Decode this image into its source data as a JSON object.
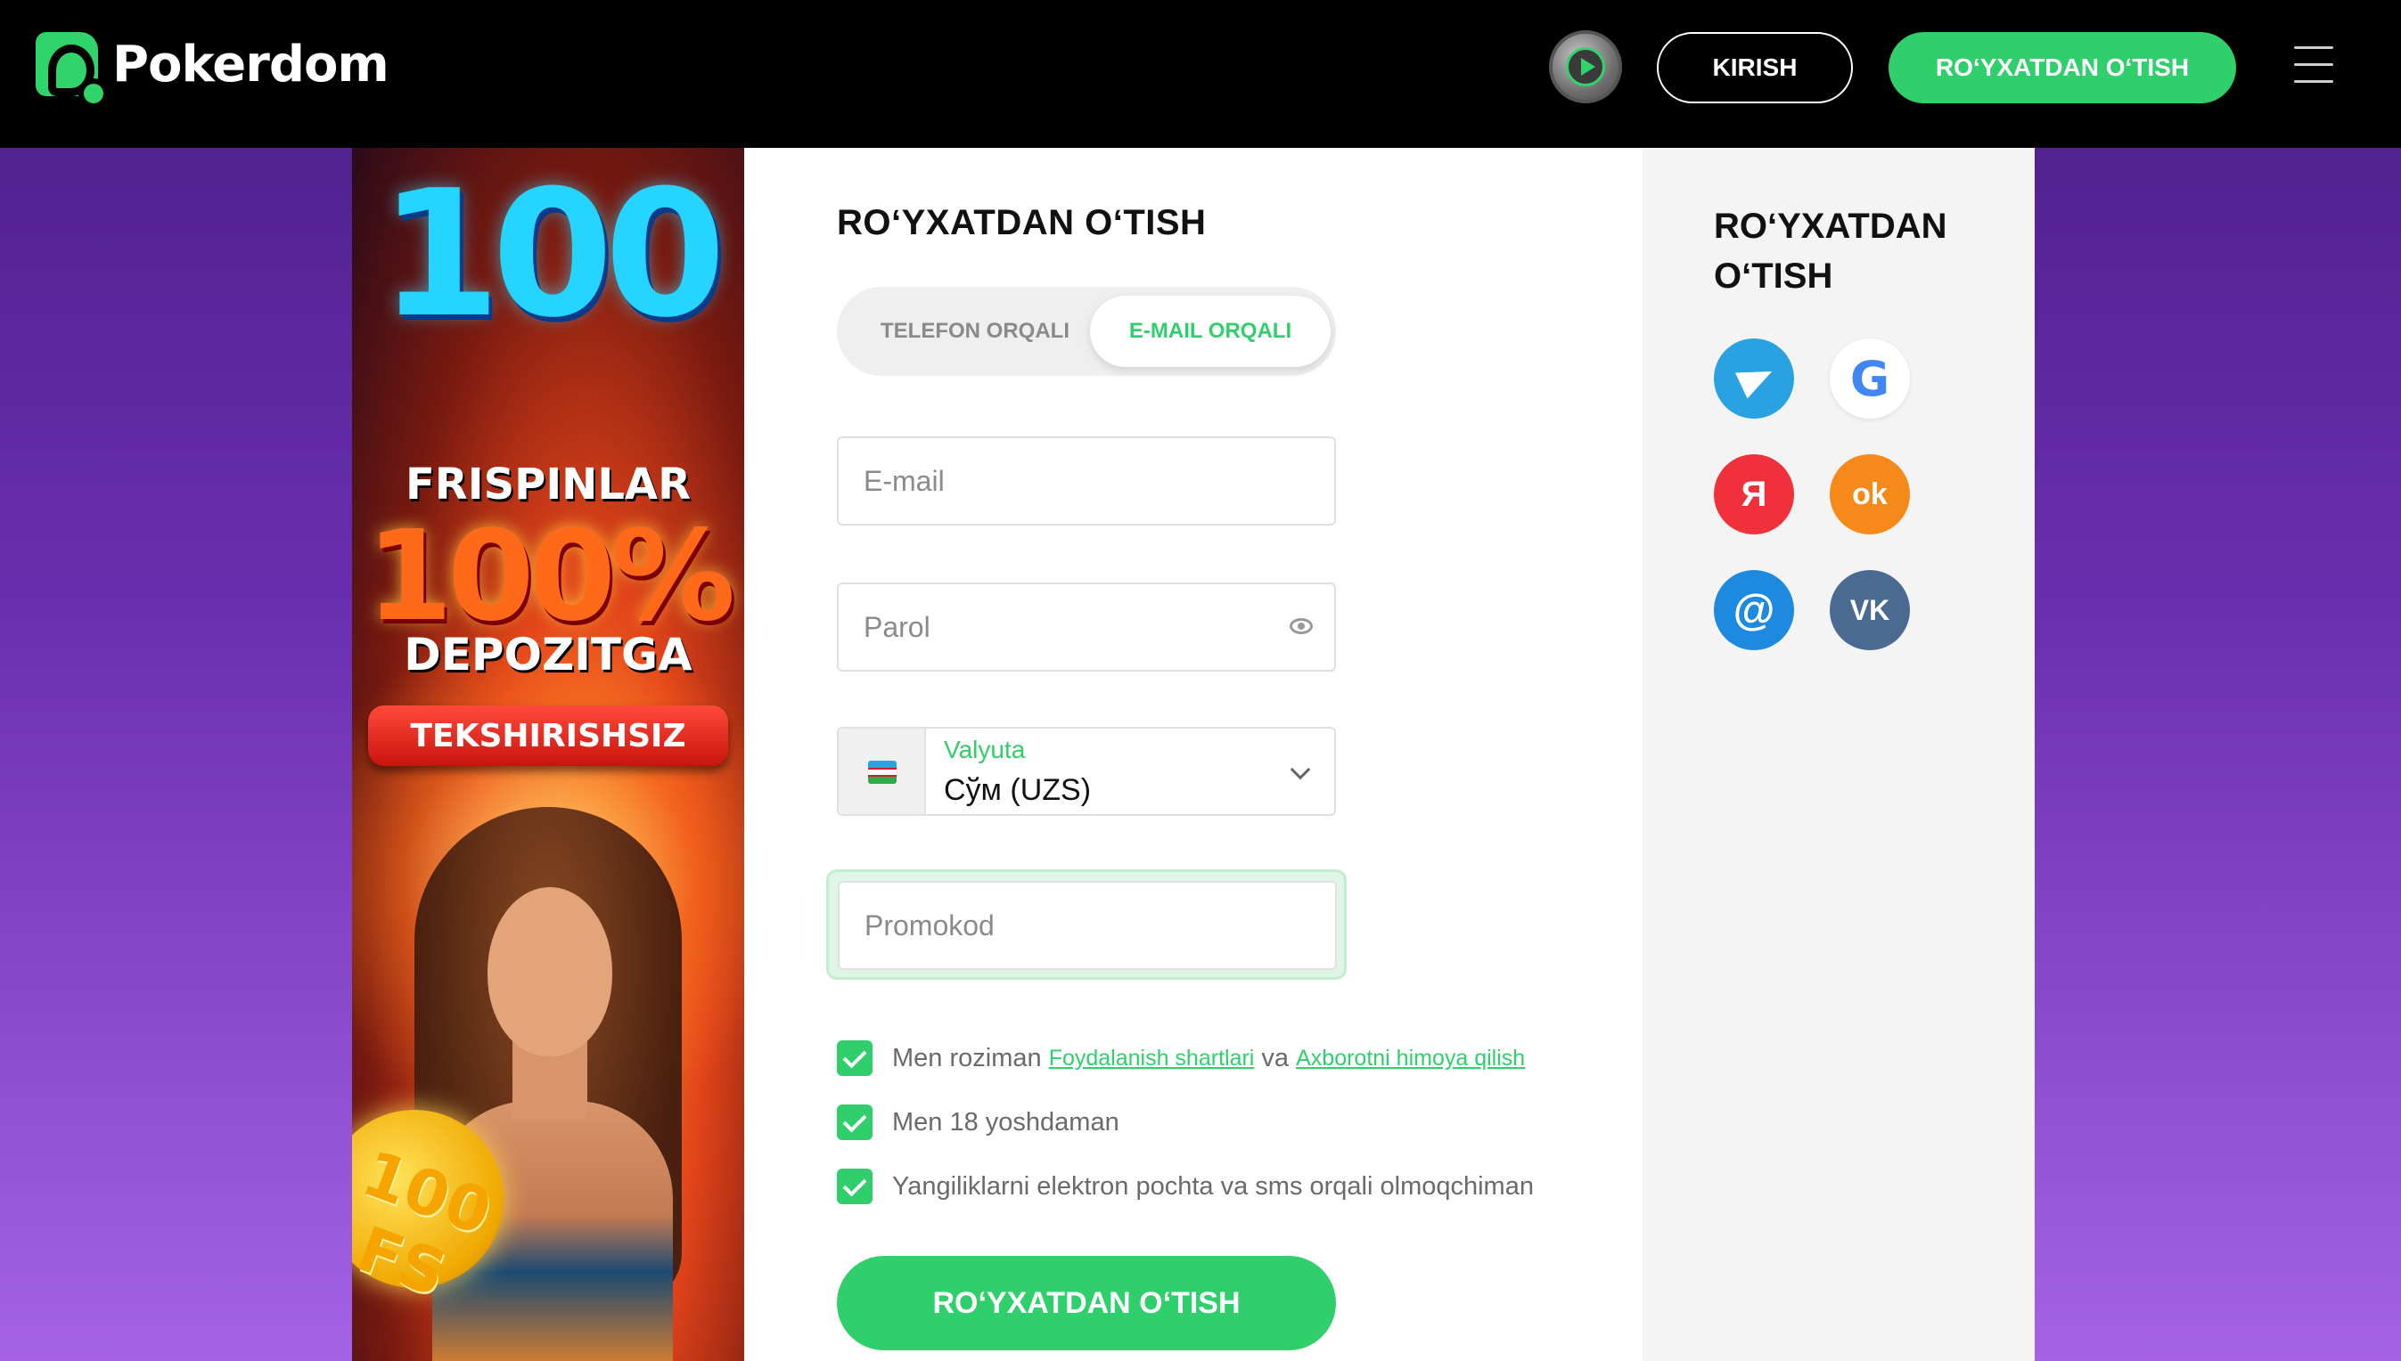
{
  "header": {
    "brand": "Pokerdom",
    "login_label": "KIRISH",
    "register_label": "RO‘YXATDAN O‘TISH"
  },
  "promo": {
    "big_number": "100",
    "line1": "FRISPINLAR",
    "percent": "100%",
    "line2": "DEPOZITGA",
    "ribbon": "TEKSHIRISHSIZ",
    "coin_text": "100 FS"
  },
  "form": {
    "title": "RO‘YXATDAN O‘TISH",
    "tab_phone": "TELEFON ORQALI",
    "tab_email": "E-MAIL ORQALI",
    "email_placeholder": "E-mail",
    "password_placeholder": "Parol",
    "currency_label": "Valyuta",
    "currency_value": "Сўм (UZS)",
    "promo_placeholder": "Promokod",
    "terms_prefix": "Men roziman",
    "terms_link": "Foydalanish shartlari",
    "terms_and": "va",
    "privacy_link": "Axborotni himoya qilish",
    "age_label": "Men 18 yoshdaman",
    "news_label": "Yangiliklarni elektron pochta va sms orqali olmoqchiman",
    "submit_label": "RO‘YXATDAN O‘TISH"
  },
  "social": {
    "title": "RO‘YXATDAN O‘TISH",
    "icons": [
      "telegram-icon",
      "google-icon",
      "yandex-icon",
      "odnoklassniki-icon",
      "mail-icon",
      "vk-icon"
    ],
    "yandex_glyph": "Я",
    "mail_glyph": "@",
    "vk_glyph": "VK",
    "ok_glyph": "ok",
    "google_glyph": "G"
  },
  "colors": {
    "accent": "#2fcf6b",
    "header_bg": "#000000"
  }
}
